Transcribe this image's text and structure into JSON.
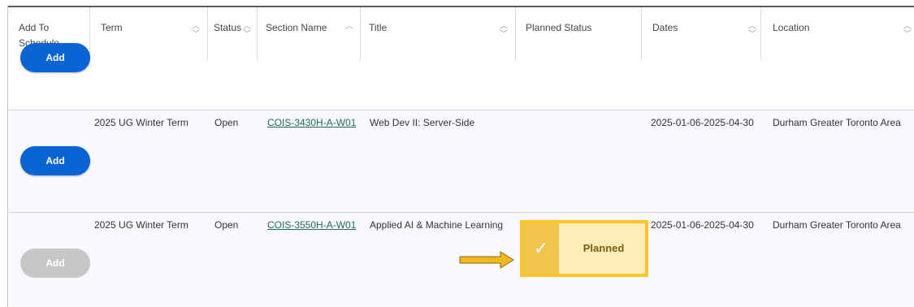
{
  "columns": [
    {
      "key": "add",
      "label_line1": "Add To",
      "label_line2": "Schedule",
      "sortable": false
    },
    {
      "key": "term",
      "label": "Term",
      "sortable": true
    },
    {
      "key": "status",
      "label": "Status",
      "sortable": true
    },
    {
      "key": "section",
      "label": "Section Name",
      "sortable": true
    },
    {
      "key": "title",
      "label": "Title",
      "sortable": true
    },
    {
      "key": "planned",
      "label": "Planned Status",
      "sortable": false
    },
    {
      "key": "dates",
      "label": "Dates",
      "sortable": true
    },
    {
      "key": "location",
      "label": "Location",
      "sortable": true
    }
  ],
  "rows": [
    {
      "add_label": "Add",
      "add_enabled": true,
      "term": "",
      "status": "",
      "section": "",
      "title": "",
      "planned": "",
      "dates": "",
      "location": ""
    },
    {
      "add_label": "Add",
      "add_enabled": true,
      "term": "2025 UG Winter Term",
      "status": "Open",
      "section": "COIS-3430H-A-W01",
      "title": "Web Dev II: Server-Side",
      "planned": "",
      "dates": "2025-01-06-2025-04-30",
      "location": "Durham Greater Toronto Area"
    },
    {
      "add_label": "Add",
      "add_enabled": false,
      "term": "2025 UG Winter Term",
      "status": "Open",
      "section": "COIS-3550H-A-W01",
      "title": "Applied AI & Machine Learning",
      "planned": "Planned",
      "dates": "2025-01-06-2025-04-30",
      "location": "Durham Greater Toronto Area"
    }
  ],
  "annotation": {
    "highlight_color": "#fac529",
    "arrow_color": "#f0b81c",
    "check_icon": "checkmark-icon"
  },
  "colors": {
    "primary_button": "#0b64d6",
    "disabled_button": "#c7c7c7",
    "link": "#1d6c5a"
  }
}
